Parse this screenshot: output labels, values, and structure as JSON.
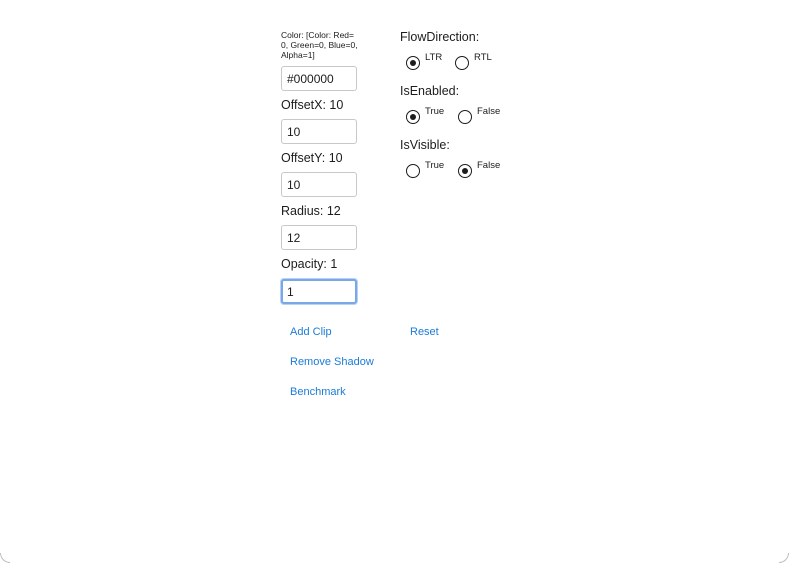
{
  "shadow": {
    "color_label": "Color: [Color: Red=0, Green=0, Blue=0, Alpha=1]",
    "color_value": "#000000",
    "offset_x_label": "OffsetX: 10",
    "offset_x_value": "10",
    "offset_y_label": "OffsetY: 10",
    "offset_y_value": "10",
    "radius_label": "Radius: 12",
    "radius_value": "12",
    "opacity_label": "Opacity: 1",
    "opacity_value": "1"
  },
  "flow_direction": {
    "label": "FlowDirection:",
    "options": [
      {
        "label": "LTR",
        "checked": true
      },
      {
        "label": "RTL",
        "checked": false
      }
    ]
  },
  "is_enabled": {
    "label": "IsEnabled:",
    "options": [
      {
        "label": "True",
        "checked": true
      },
      {
        "label": "False",
        "checked": false
      }
    ]
  },
  "is_visible": {
    "label": "IsVisible:",
    "options": [
      {
        "label": "True",
        "checked": false
      },
      {
        "label": "False",
        "checked": true
      }
    ]
  },
  "buttons": {
    "add_clip": "Add Clip",
    "reset": "Reset",
    "remove_shadow": "Remove Shadow",
    "benchmark": "Benchmark"
  }
}
